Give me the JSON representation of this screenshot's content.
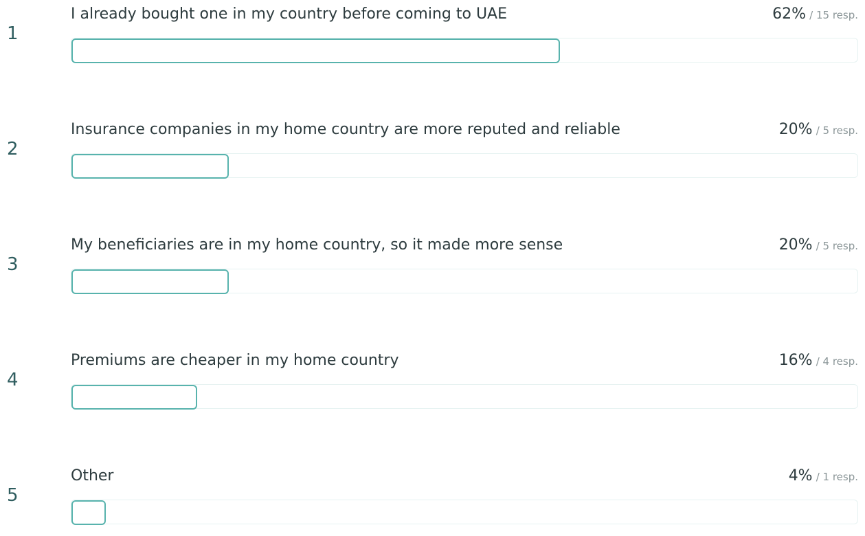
{
  "chart_data": {
    "type": "bar",
    "orientation": "horizontal",
    "categories": [
      "I already bought one in my country before coming to UAE",
      "Insurance companies in my home country are more reputed and reliable",
      "My beneficiaries are in my home country, so it made more sense",
      "Premiums are cheaper in my home country",
      "Other"
    ],
    "values": [
      62,
      20,
      20,
      16,
      4
    ],
    "xlim": [
      0,
      100
    ]
  },
  "rows": [
    {
      "rank": "1",
      "label": "I already bought one in my country before coming to UAE",
      "percent": "62%",
      "responses": "/ 15 resp."
    },
    {
      "rank": "2",
      "label": "Insurance companies in my home country are more reputed and reliable",
      "percent": "20%",
      "responses": "/ 5 resp."
    },
    {
      "rank": "3",
      "label": "My beneficiaries are in my home country, so it made more sense",
      "percent": "20%",
      "responses": "/ 5 resp."
    },
    {
      "rank": "4",
      "label": "Premiums are cheaper in my home country",
      "percent": "16%",
      "responses": "/ 4 resp."
    },
    {
      "rank": "5",
      "label": "Other",
      "percent": "4%",
      "responses": "/ 1 resp."
    }
  ],
  "colors": {
    "bar_border": "#58b3ad",
    "track_border": "#e6f2f1",
    "rank_text": "#2f5d5f",
    "label_text": "#2d3b3e",
    "muted_text": "#8a9597"
  }
}
